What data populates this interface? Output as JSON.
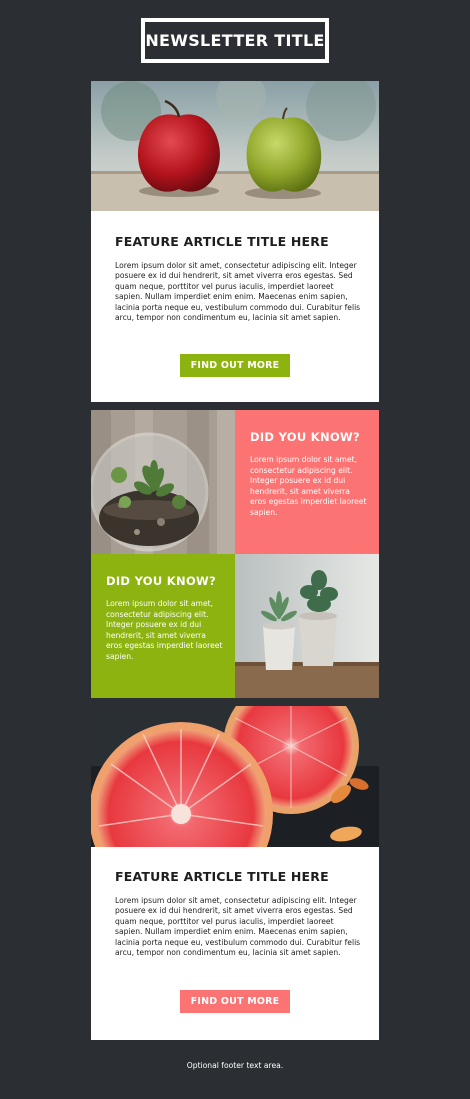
{
  "header": {
    "title": "NEWSLETTER TITLE"
  },
  "feature1": {
    "image": "apples-photo",
    "title": "FEATURE ARTICLE TITLE HERE",
    "body": "Lorem ipsum dolor sit amet, consectetur adipiscing elit. Integer posuere ex id dui hendrerit, sit amet viverra eros egestas. Sed quam neque, porttitor vel purus iaculis, imperdiet laoreet sapien. Nullam imperdiet enim enim. Maecenas enim sapien, lacinia porta neque eu, vestibulum commodo dui. Curabitur felis arcu, tempor non condimentum eu, lacinia sit amet sapien.",
    "button_label": "FIND OUT MORE"
  },
  "did_you_know_1": {
    "image": "terrarium-photo",
    "title": "DID YOU KNOW?",
    "body": "Lorem ipsum dolor sit amet, consectetur adipiscing elit. Integer posuere ex id dui hendrerit, sit amet viverra eros egestas imperdiet laoreet sapien."
  },
  "did_you_know_2": {
    "image": "succulents-photo",
    "title": "DID YOU KNOW?",
    "body": "Lorem ipsum dolor sit amet, consectetur adipiscing elit. Integer posuere ex id dui hendrerit, sit amet viverra eros egestas imperdiet laoreet sapien."
  },
  "feature2": {
    "image": "grapefruit-photo",
    "title": "FEATURE ARTICLE TITLE HERE",
    "body": "Lorem ipsum dolor sit amet, consectetur adipiscing elit. Integer posuere ex id dui hendrerit, sit amet viverra eros egestas. Sed quam neque, porttitor vel purus iaculis, imperdiet laoreet sapien. Nullam imperdiet enim enim. Maecenas enim sapien, lacinia porta neque eu, vestibulum commodo dui. Curabitur felis arcu, tempor non condimentum eu, lacinia sit amet sapien.",
    "button_label": "FIND OUT MORE"
  },
  "footer": {
    "text": "Optional footer text area."
  },
  "colors": {
    "background": "#2b2f33",
    "green_accent": "#8cb310",
    "coral_accent": "#fb7473",
    "card": "#ffffff"
  }
}
